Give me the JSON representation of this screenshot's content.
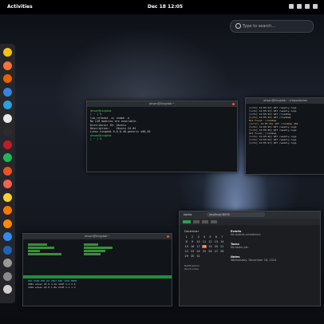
{
  "topbar": {
    "activities_label": "Activities",
    "clock": "Dec 18  12:05"
  },
  "search": {
    "placeholder": "Type to search…"
  },
  "dock": {
    "apps": [
      {
        "icon": "clock-icon",
        "color": "#f5c211"
      },
      {
        "icon": "firefox-icon",
        "color": "#ff7139"
      },
      {
        "icon": "mail-icon",
        "color": "#e66100"
      },
      {
        "icon": "files-icon",
        "color": "#3584e4"
      },
      {
        "icon": "telegram-icon",
        "color": "#2aa0e0"
      },
      {
        "icon": "chrome-icon",
        "color": "#e8e8e8"
      },
      {
        "icon": "terminal-icon",
        "color": "#2c2c2c"
      },
      {
        "icon": "settings-icon",
        "color": "#c01c28"
      },
      {
        "icon": "spotify-icon",
        "color": "#1db954"
      },
      {
        "icon": "software-icon",
        "color": "#e95420"
      },
      {
        "icon": "photos-icon",
        "color": "#f66151"
      },
      {
        "icon": "editor-icon",
        "color": "#f6d32d"
      },
      {
        "icon": "calendar-icon",
        "color": "#f57900"
      },
      {
        "icon": "music-icon",
        "color": "#ff8a00"
      },
      {
        "icon": "code-icon",
        "color": "#2d8cf0"
      },
      {
        "icon": "virtualbox-icon",
        "color": "#1e64b4"
      },
      {
        "icon": "tools-icon",
        "color": "#9a9996"
      },
      {
        "icon": "trash-icon",
        "color": "#8a8a8a"
      },
      {
        "icon": "apps-grid-icon",
        "color": "#cfcfcf"
      }
    ]
  },
  "term1": {
    "title": "ahsan@kingdak:~",
    "lines": [
      "ahsan@kingdak",
      "[ ~ ] $ ",
      "lsb_release -a; uname -a",
      "No LSB modules are available.",
      "Distributor ID: Ubuntu",
      "Description:    Ubuntu 24.04",
      "Linux kingdak 6.8.0-48-generic x86_64",
      "",
      "ahsan@kingdak",
      "[ ~ ] $ "
    ]
  },
  "term2": {
    "title": "ahsan@kingdak: ~/repositories",
    "lines": [
      "[info] 12:05:23] GET /weekly-logs",
      "[info] 12:05:23] GET /weekly-logs",
      "[info] 12:05:24] GET /roadmap",
      "[info] 12:05:24] GET /roadmap",
      "Not Found: /roadmap",
      "[error] 12:05:25] GET /roadmap 404",
      "[info] 12:05:25] GET /weekly-logs",
      "[info] 12:05:26] GET /weekly-logs",
      "Not Found: /roadmap",
      "[info] 12:05:26] GET /weekly-logs",
      "[info] 12:05:26] GET /weekly-logs",
      "[info] 12:05:27] GET /weekly-logs"
    ]
  },
  "htop": {
    "title": "ahsan@kingdak:~",
    "rows": [
      "PID USER PRI NI VIRT RES CPU% MEM%",
      "2881 ahsan 20 0 4.1G 421M 3.2 2.6",
      "1204 ahsan 20 0 1.8G 211M 1.1 1.3"
    ]
  },
  "browser": {
    "tab": "kanka",
    "url": "localhost:8000",
    "events_heading": "Events",
    "events_text": "No events scheduled.",
    "tasks_heading": "Tasks",
    "tasks_text": "No tasks yet.",
    "notes_heading": "Notes",
    "notes_text": "Wednesday, December 18, 2024",
    "calendar_month": "December",
    "days": [
      "1",
      "2",
      "3",
      "4",
      "5",
      "6",
      "7",
      "8",
      "9",
      "10",
      "11",
      "12",
      "13",
      "14",
      "15",
      "16",
      "17",
      "18",
      "19",
      "20",
      "21",
      "22",
      "23",
      "24",
      "25",
      "26",
      "27",
      "28",
      "29",
      "30",
      "31"
    ],
    "selected_day": "18",
    "bottom_lines": [
      "Notifications",
      "Quick notes"
    ]
  }
}
